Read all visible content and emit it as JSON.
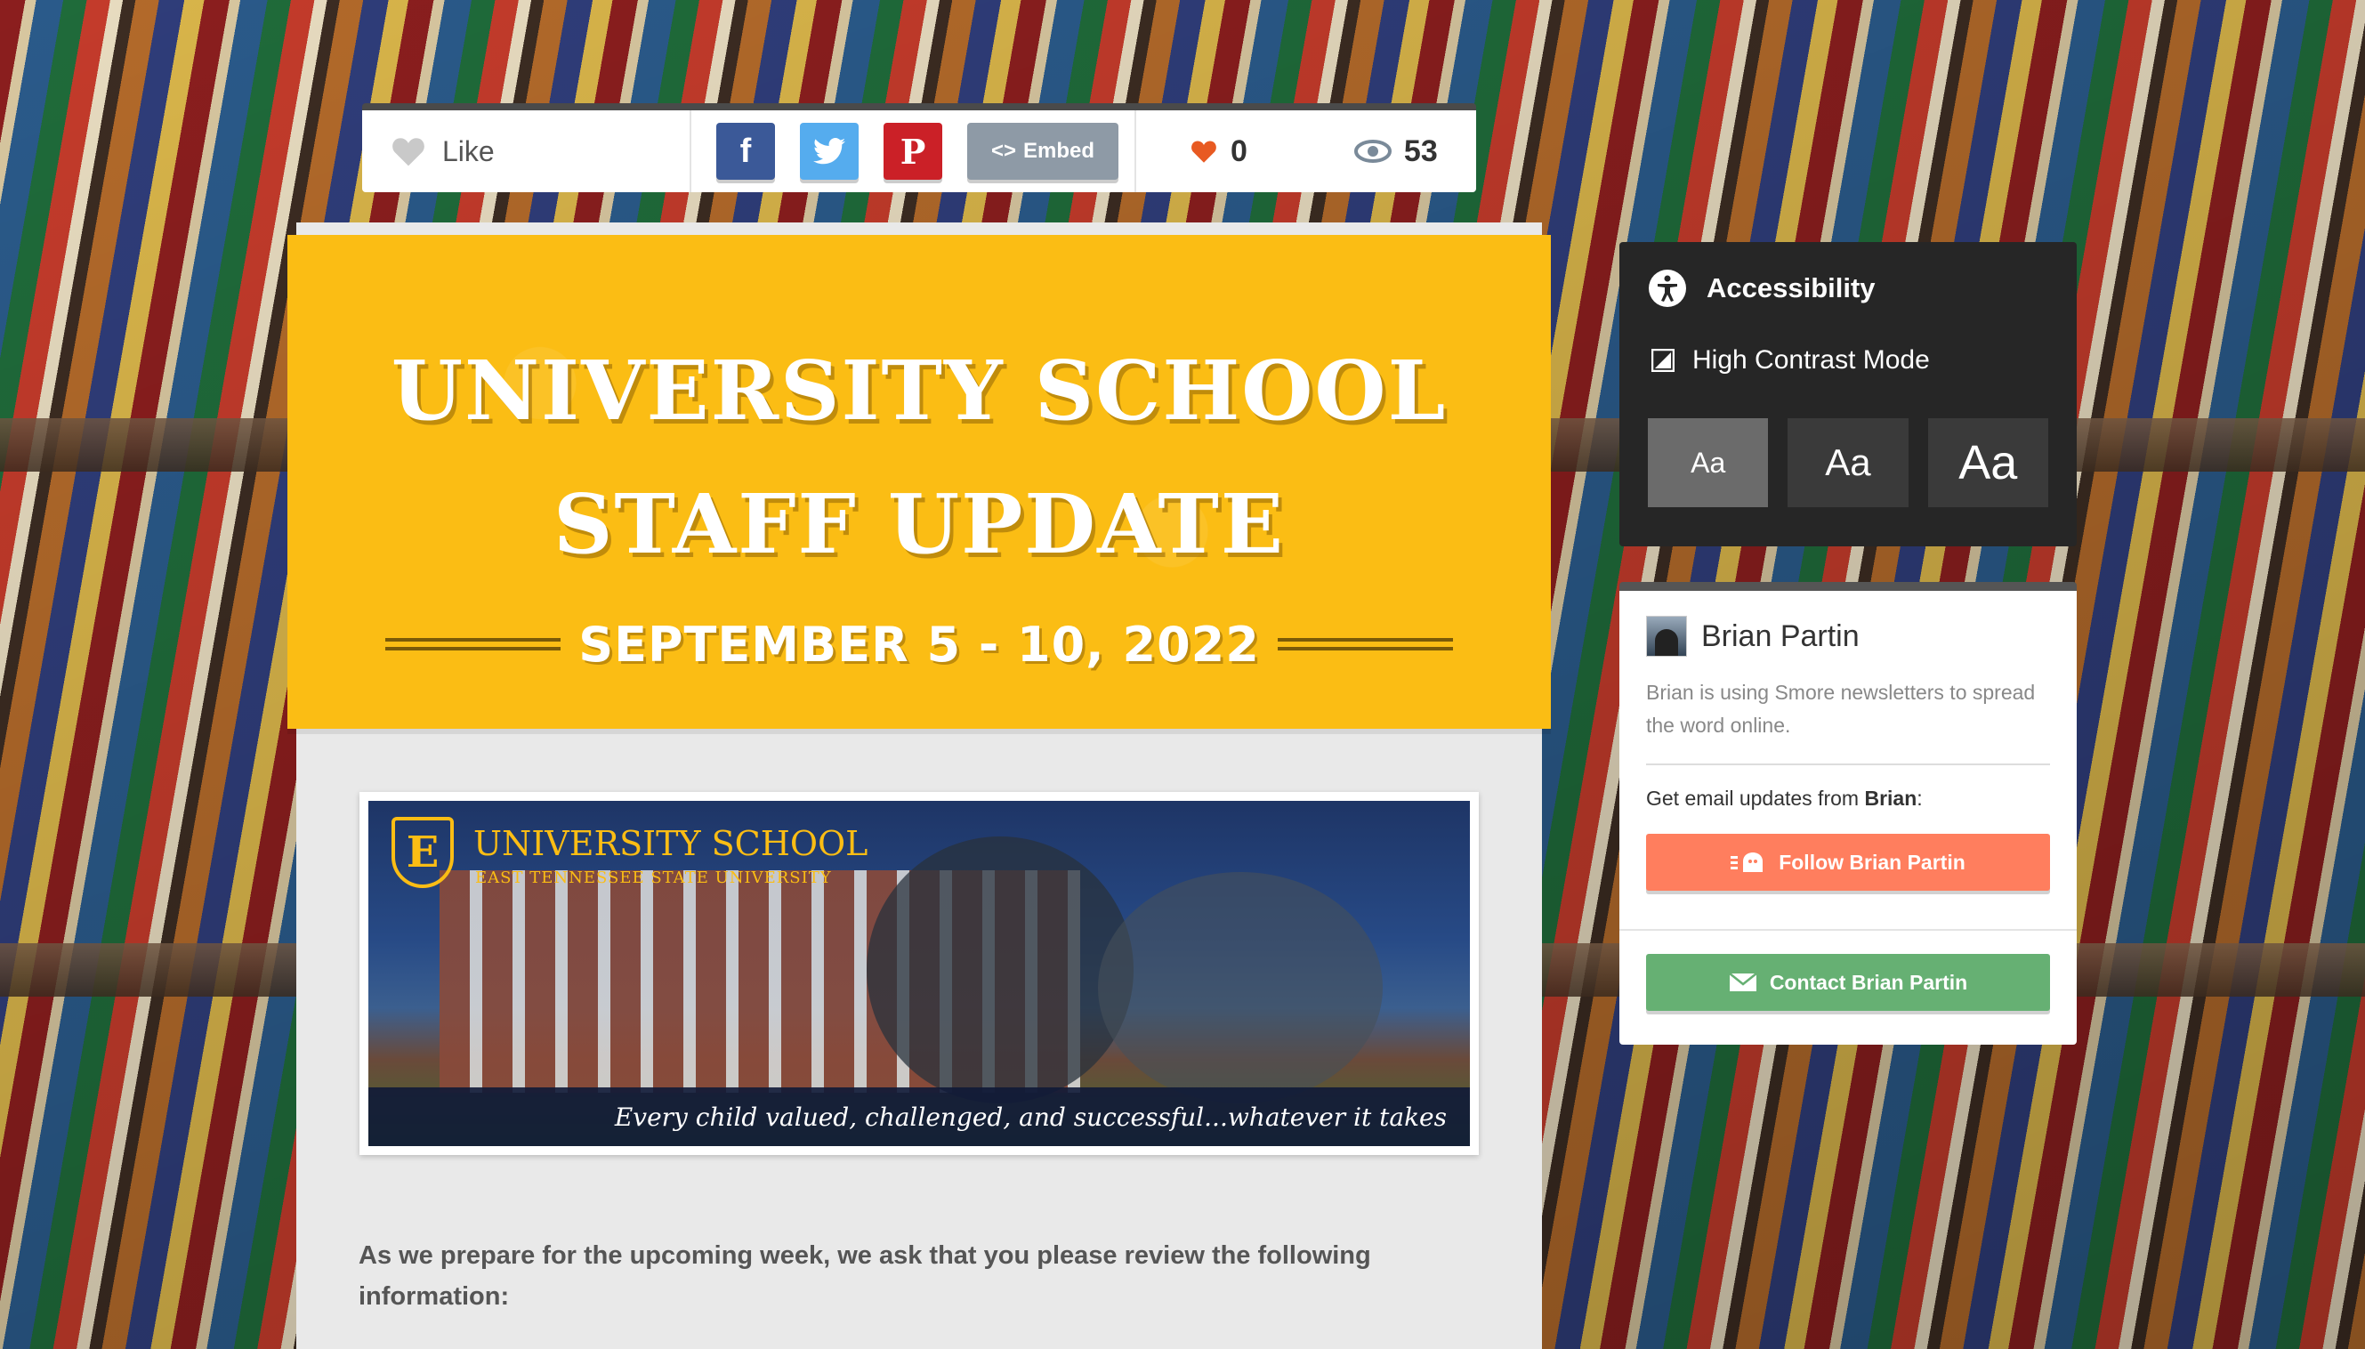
{
  "sharebar": {
    "like_label": "Like",
    "embed_label": "Embed",
    "likes_count": "0",
    "views_count": "53"
  },
  "newsletter": {
    "title_line1": "UNIVERSITY SCHOOL",
    "title_line2": "STAFF UPDATE",
    "date": "SEPTEMBER 5 - 10, 2022",
    "banner": {
      "crest_letter": "E",
      "school_name": "UNIVERSITY SCHOOL",
      "school_sub": "EAST TENNESSEE STATE UNIVERSITY",
      "tagline": "Every child valued, challenged, and successful...whatever it takes"
    },
    "intro_text": "As we prepare for the upcoming week, we ask that you please review the following information:"
  },
  "accessibility": {
    "title": "Accessibility",
    "high_contrast_label": "High Contrast Mode",
    "font_sizes": [
      "Aa",
      "Aa",
      "Aa"
    ]
  },
  "author": {
    "name": "Brian Partin",
    "description": "Brian is using Smore newsletters to spread the word online.",
    "email_prefix": "Get email updates from ",
    "email_name": "Brian",
    "email_suffix": ":",
    "follow_label": "Follow Brian Partin",
    "contact_label": "Contact Brian Partin"
  },
  "colors": {
    "header_yellow": "#fbbd14",
    "follow_orange": "#ff7e5e",
    "contact_green": "#66b073",
    "facebook": "#3b5998",
    "twitter": "#55acee",
    "pinterest": "#cb2027"
  }
}
